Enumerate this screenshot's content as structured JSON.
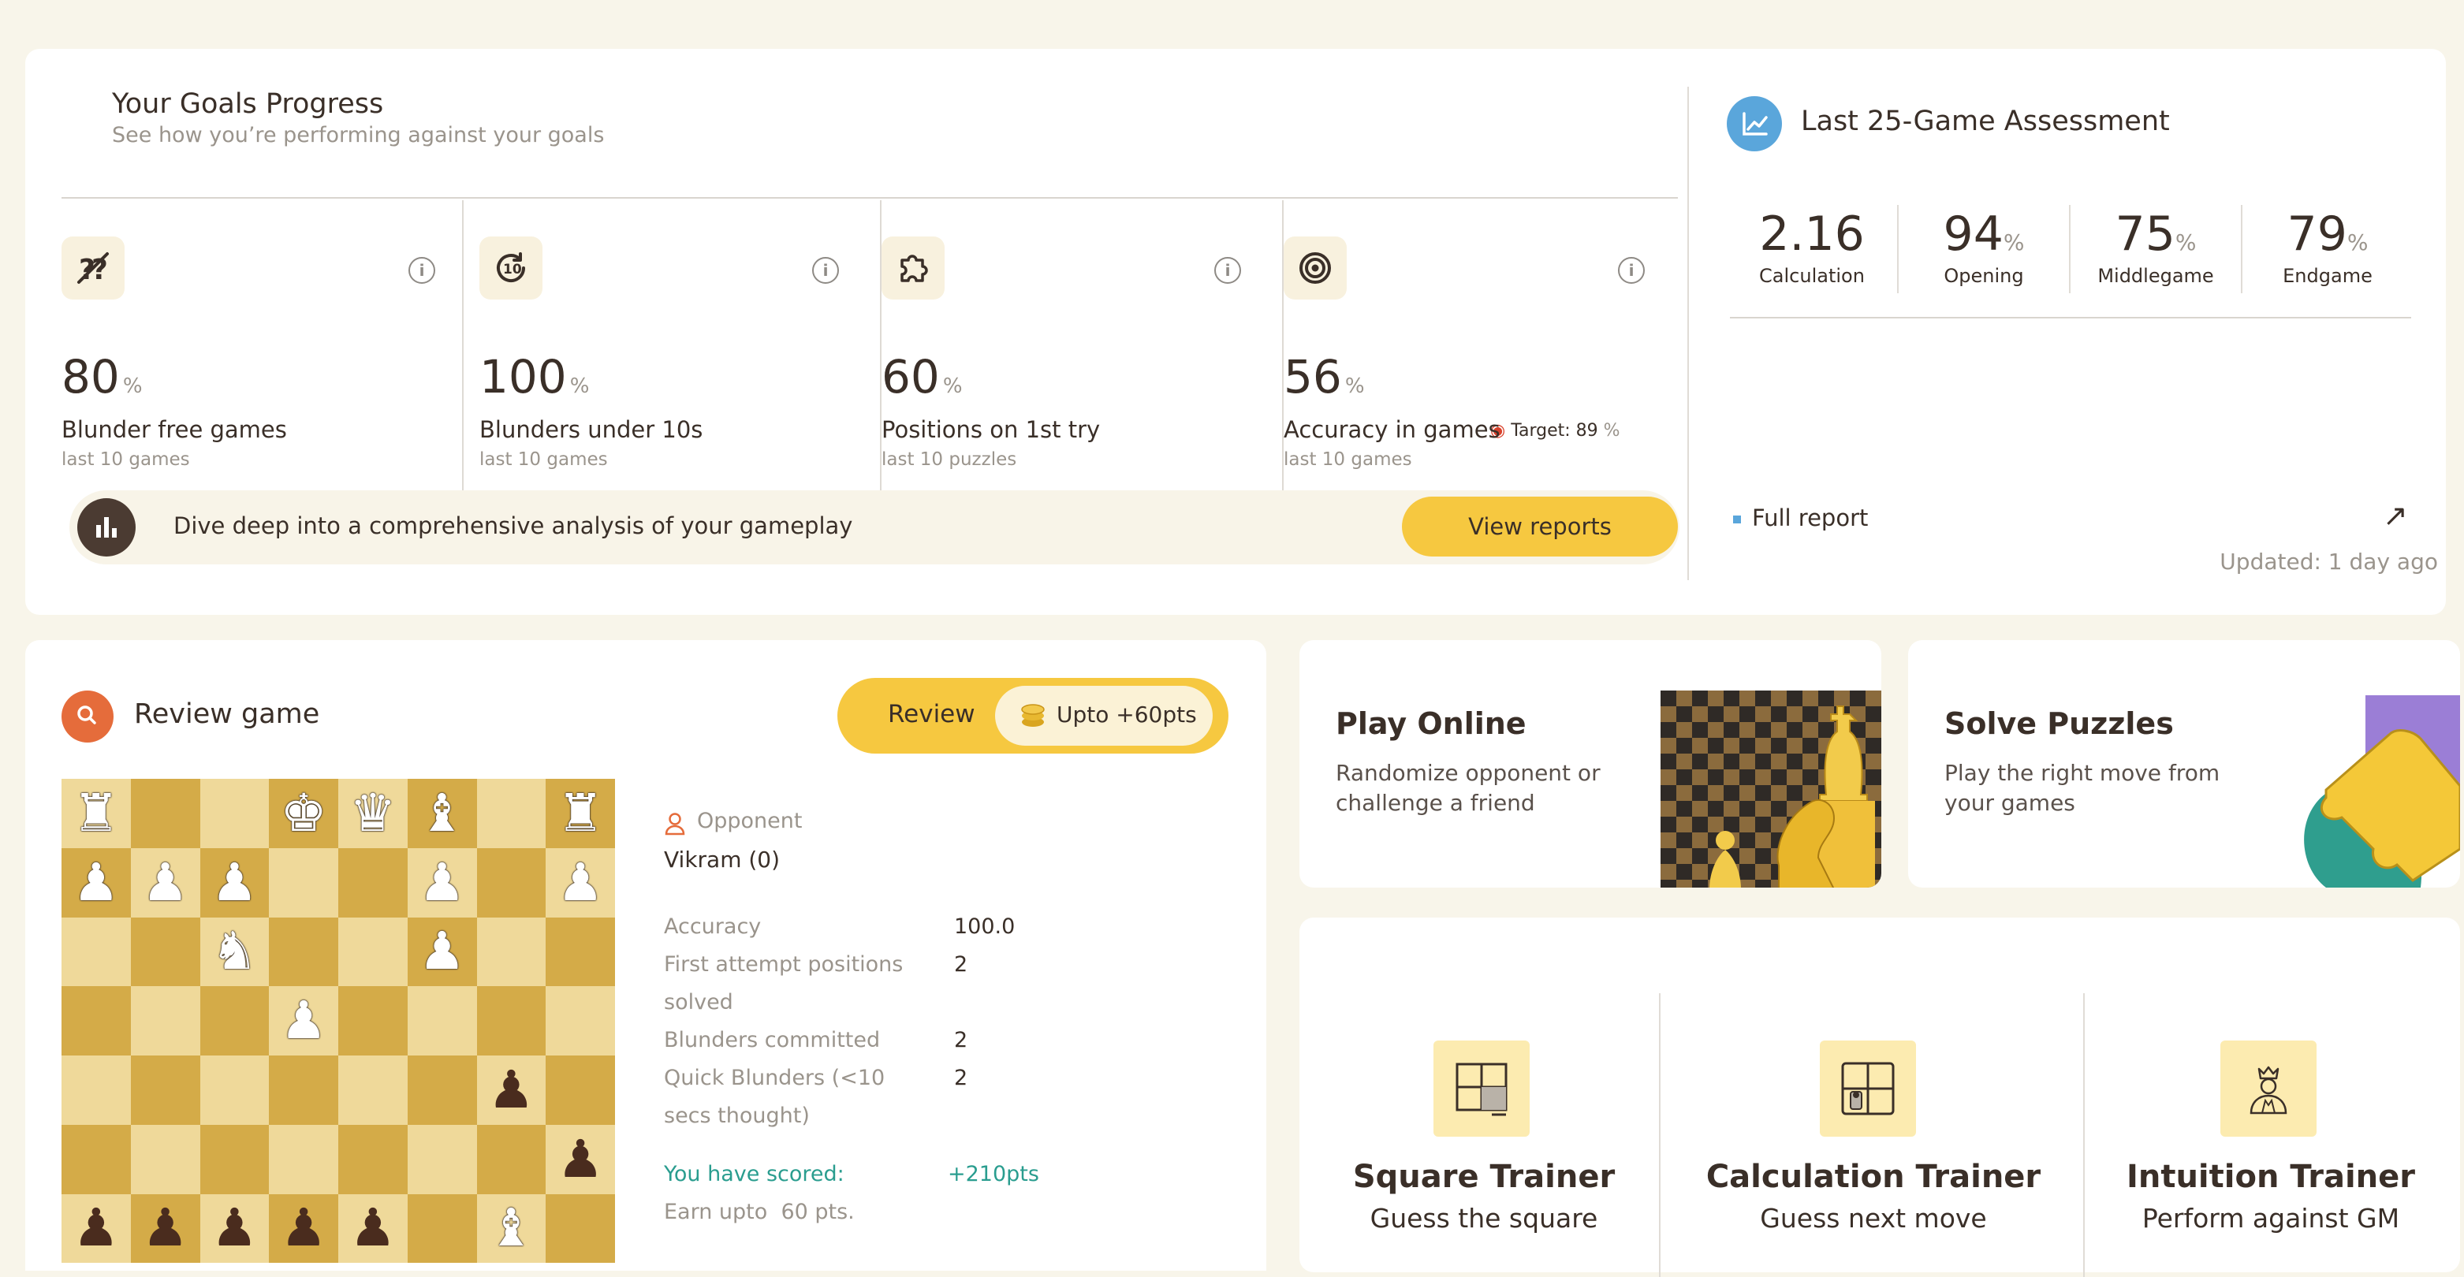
{
  "goals": {
    "title": "Your Goals Progress",
    "subtitle": "See how you’re performing against your goals",
    "stats": [
      {
        "icon": "question-slash-icon",
        "value": "80",
        "unit": "%",
        "label": "Blunder free games",
        "sub": "last 10 games"
      },
      {
        "icon": "timer-10-icon",
        "value": "100",
        "unit": "%",
        "label": "Blunders under 10s",
        "sub": "last 10 games"
      },
      {
        "icon": "puzzle-icon",
        "value": "60",
        "unit": "%",
        "label": "Positions on 1st try",
        "sub": "last 10 puzzles"
      },
      {
        "icon": "target-icon",
        "value": "56",
        "unit": "%",
        "label": "Accuracy in games",
        "sub": "last 10 games",
        "target_label": "Target: 89",
        "target_unit": "%"
      }
    ],
    "banner_text": "Dive deep into a comprehensive analysis of your gameplay",
    "banner_button": "View reports"
  },
  "assessment": {
    "title": "Last 25-Game Assessment",
    "items": [
      {
        "value": "2.16",
        "unit": "",
        "label": "Calculation"
      },
      {
        "value": "94",
        "unit": "%",
        "label": "Opening"
      },
      {
        "value": "75",
        "unit": "%",
        "label": "Middlegame"
      },
      {
        "value": "79",
        "unit": "%",
        "label": "Endgame"
      }
    ],
    "full_report": "Full report",
    "updated": "Updated: 1 day ago"
  },
  "review": {
    "title": "Review game",
    "button": "Review",
    "reward": "Upto +60pts",
    "opponent_label": "Opponent",
    "opponent_name": "Vikram (0)",
    "stats": [
      {
        "label": "Accuracy",
        "value": "100.0"
      },
      {
        "label": "First attempt positions solved",
        "value": "2"
      },
      {
        "label": "Blunders committed",
        "value": "2"
      },
      {
        "label": "Quick Blunders (<10 secs thought)",
        "value": "2"
      }
    ],
    "score_label": "You have scored:",
    "score_value": "+210pts",
    "earn_text": "Earn upto  60 pts.",
    "board_rows": [
      [
        "wR",
        "",
        "",
        "wK",
        "wQ",
        "wB",
        "",
        "wR"
      ],
      [
        "wP",
        "wP",
        "wP",
        "",
        "",
        "wP",
        "",
        "wP"
      ],
      [
        "",
        "",
        "wN",
        "",
        "",
        "wP",
        "",
        ""
      ],
      [
        "",
        "",
        "",
        "wP",
        "",
        "",
        "",
        ""
      ],
      [
        "",
        "",
        "",
        "",
        "",
        "",
        "bP",
        ""
      ],
      [
        "",
        "",
        "",
        "",
        "",
        "",
        "",
        "bP"
      ],
      [
        "bP",
        "bP",
        "bP",
        "bP",
        "bP",
        "",
        "wB",
        ""
      ]
    ]
  },
  "play_online": {
    "title": "Play Online",
    "subtitle": "Randomize opponent or challenge a friend"
  },
  "puzzles": {
    "title": "Solve Puzzles",
    "subtitle": "Play the right move from your games"
  },
  "trainers": [
    {
      "icon": "square-grid-icon",
      "title": "Square Trainer",
      "subtitle": "Guess the square"
    },
    {
      "icon": "calculation-board-icon",
      "title": "Calculation Trainer",
      "subtitle": "Guess next move"
    },
    {
      "icon": "grandmaster-icon",
      "title": "Intuition Trainer",
      "subtitle": "Perform against GM"
    }
  ],
  "colors": {
    "accent_yellow": "#f6c840",
    "page_bg": "#f8f5ea",
    "review_orange": "#e56c3b",
    "assessment_blue": "#5aa6db",
    "score_teal": "#2a9d8f"
  }
}
